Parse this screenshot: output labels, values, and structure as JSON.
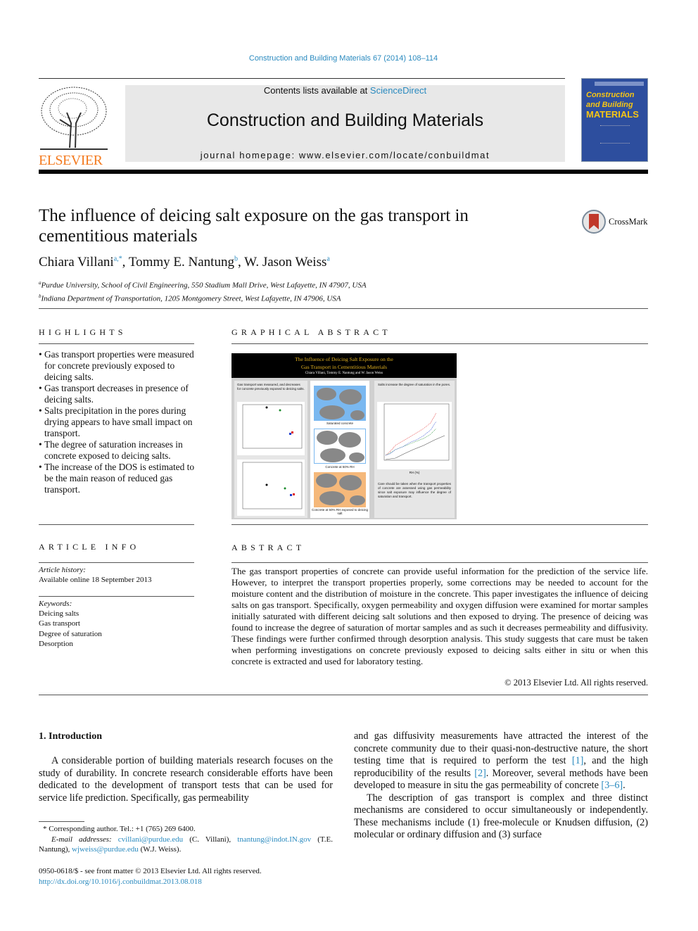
{
  "header": {
    "citation": "Construction and Building Materials 67 (2014) 108–114",
    "contents_prefix": "Contents lists available at ",
    "contents_link": "ScienceDirect",
    "journal_title": "Construction and Building Materials",
    "homepage": "journal homepage: www.elsevier.com/locate/conbuildmat",
    "publisher_logo": "ELSEVIER",
    "cover_title": [
      "Construction",
      "and Building",
      "MATERIALS"
    ],
    "colors": {
      "link": "#2a8abf",
      "elsevier_orange": "#f47b20",
      "cover_blue": "#2d4e9e",
      "cover_yellow": "#f6c514"
    }
  },
  "article": {
    "title": "The influence of deicing salt exposure on the gas transport in cementitious materials",
    "crossmark": "CrossMark",
    "authors": [
      {
        "name": "Chiara Villani",
        "sup": "a,*",
        "sep": ", "
      },
      {
        "name": "Tommy E. Nantung",
        "sup": "b",
        "sep": ", "
      },
      {
        "name": "W. Jason Weiss",
        "sup": "a",
        "sep": ""
      }
    ],
    "affiliations": [
      {
        "sup": "a",
        "text": "Purdue University, School of Civil Engineering, 550 Stadium Mall Drive, West Lafayette, IN 47907, USA"
      },
      {
        "sup": "b",
        "text": "Indiana Department of Transportation, 1205 Montgomery Street, West Lafayette, IN 47906, USA"
      }
    ]
  },
  "highlights": {
    "heading": "HIGHLIGHTS",
    "items": [
      "Gas transport properties were measured for concrete previously exposed to deicing salts.",
      "Gas transport decreases in presence of deicing salts.",
      "Salts precipitation in the pores during drying appears to have small impact on transport.",
      "The degree of saturation increases in concrete exposed to deicing salts.",
      "The increase of the DOS is estimated to be the main reason of reduced gas transport."
    ]
  },
  "graphical_abstract": {
    "heading": "GRAPHICAL ABSTRACT",
    "image_title": [
      "The Influence of Deicing Salt Exposure on the",
      "Gas Transport in Cementitious Materials"
    ],
    "image_authors": "Chiara Villani, Tommy E. Nantung and W. Jason Weiss",
    "left_caption": "Gas transport was measured, and decreases for concrete previously exposed to deicing salts.",
    "middle_labels": [
      "Saturated concrete",
      "Concrete at 50% RH",
      "Concrete at 50% RH exposed to deicing salt"
    ],
    "right_caption_top": "Salts increase the degree of saturation in the pores.",
    "right_caption_bottom": "Care should be taken when the transport properties of concrete are assessed using gas permeability since salt exposure may influence the degree of saturation and transport.",
    "right_xlabel": "RH (%)"
  },
  "article_info": {
    "heading": "ARTICLE INFO",
    "history_label": "Article history:",
    "history": "Available online 18 September 2013",
    "keywords_label": "Keywords:",
    "keywords": [
      "Deicing salts",
      "Gas transport",
      "Degree of saturation",
      "Desorption"
    ]
  },
  "abstract": {
    "heading": "ABSTRACT",
    "text": "The gas transport properties of concrete can provide useful information for the prediction of the service life. However, to interpret the transport properties properly, some corrections may be needed to account for the moisture content and the distribution of moisture in the concrete. This paper investigates the influence of deicing salts on gas transport. Specifically, oxygen permeability and oxygen diffusion were examined for mortar samples initially saturated with different deicing salt solutions and then exposed to drying. The presence of deicing was found to increase the degree of saturation of mortar samples and as such it decreases permeability and diffusivity. These findings were further confirmed through desorption analysis. This study suggests that care must be taken when performing investigations on concrete previously exposed to deicing salts either in situ or when this concrete is extracted and used for laboratory testing.",
    "copyright": "© 2013 Elsevier Ltd. All rights reserved."
  },
  "intro": {
    "heading": "1. Introduction",
    "left": "A considerable portion of building materials research focuses on the study of durability. In concrete research considerable efforts have been dedicated to the development of transport tests that can be used for service life prediction. Specifically, gas permeability",
    "right_p1_a": "and gas diffusivity measurements have attracted the interest of the concrete community due to their quasi-non-destructive nature, the short testing time that is required to perform the test ",
    "ref1": "[1]",
    "right_p1_b": ", and the high reproducibility of the results ",
    "ref2": "[2]",
    "right_p1_c": ". Moreover, several methods have been developed to measure in situ the gas permeability of concrete ",
    "ref3": "[3–6]",
    "right_p1_d": ".",
    "right_p2": "The description of gas transport is complex and three distinct mechanisms are considered to occur simultaneously or independently. These mechanisms include (1) free-molecule or Knudsen diffusion, (2) molecular or ordinary diffusion and (3) surface"
  },
  "footnotes": {
    "corresponding": "Corresponding author. Tel.: +1 (765) 269 6400.",
    "email_label": "E-mail addresses:",
    "emails": [
      {
        "addr": "cvillani@purdue.edu",
        "who": " (C. Villani), "
      },
      {
        "addr": "tnantung@indot.IN.gov",
        "who": " (T.E. Nantung), "
      },
      {
        "addr": "wjweiss@purdue.edu",
        "who": " (W.J. Weiss)."
      }
    ],
    "issn": "0950-0618/$ - see front matter © 2013 Elsevier Ltd. All rights reserved.",
    "doi": "http://dx.doi.org/10.1016/j.conbuildmat.2013.08.018"
  }
}
